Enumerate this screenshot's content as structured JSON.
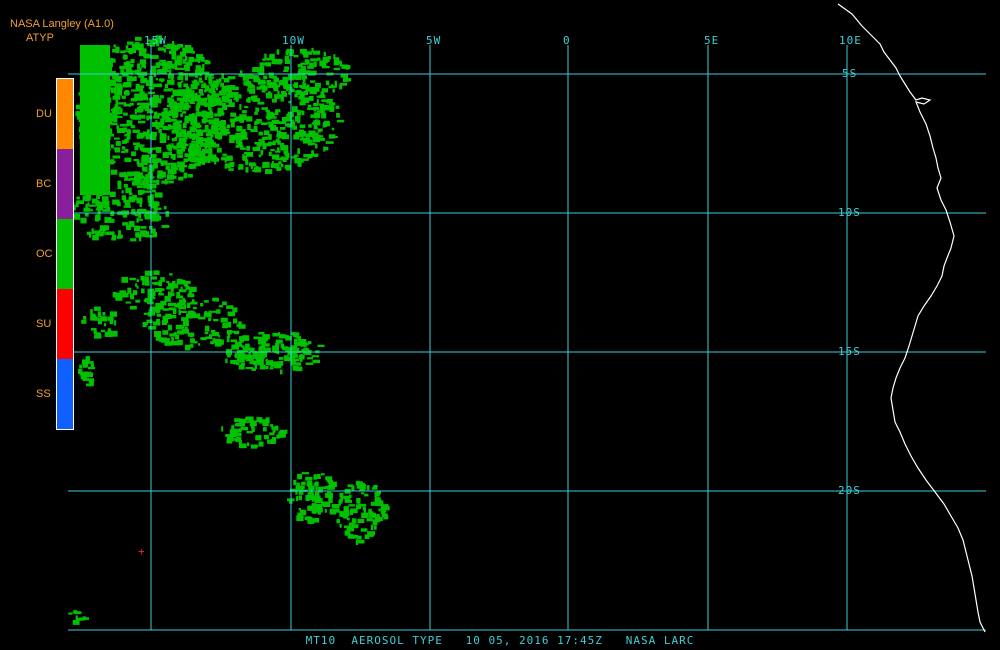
{
  "header": {
    "line1": "NASA Langley (A1.0)",
    "line2": "ATYP"
  },
  "legend": {
    "items": [
      {
        "code": "DU",
        "color": "#ff8800"
      },
      {
        "code": "BC",
        "color": "#8a1f9c"
      },
      {
        "code": "OC",
        "color": "#00c000"
      },
      {
        "code": "SU",
        "color": "#ff0000"
      },
      {
        "code": "SS",
        "color": "#1060ff"
      }
    ]
  },
  "grid": {
    "color": "#3dd0d8",
    "lon_labels": [
      "15W",
      "10W",
      "5W",
      "0",
      "5E",
      "10E"
    ],
    "lat_labels": [
      "5S",
      "10S",
      "15S",
      "20S"
    ]
  },
  "footer": {
    "text": "MT10  AEROSOL TYPE   10 05, 2016 17:45Z   NASA LARC"
  },
  "colors": {
    "aerosol": "#00c000",
    "coastline": "#ffffff",
    "background": "#000000",
    "marker": "#ff2020"
  }
}
